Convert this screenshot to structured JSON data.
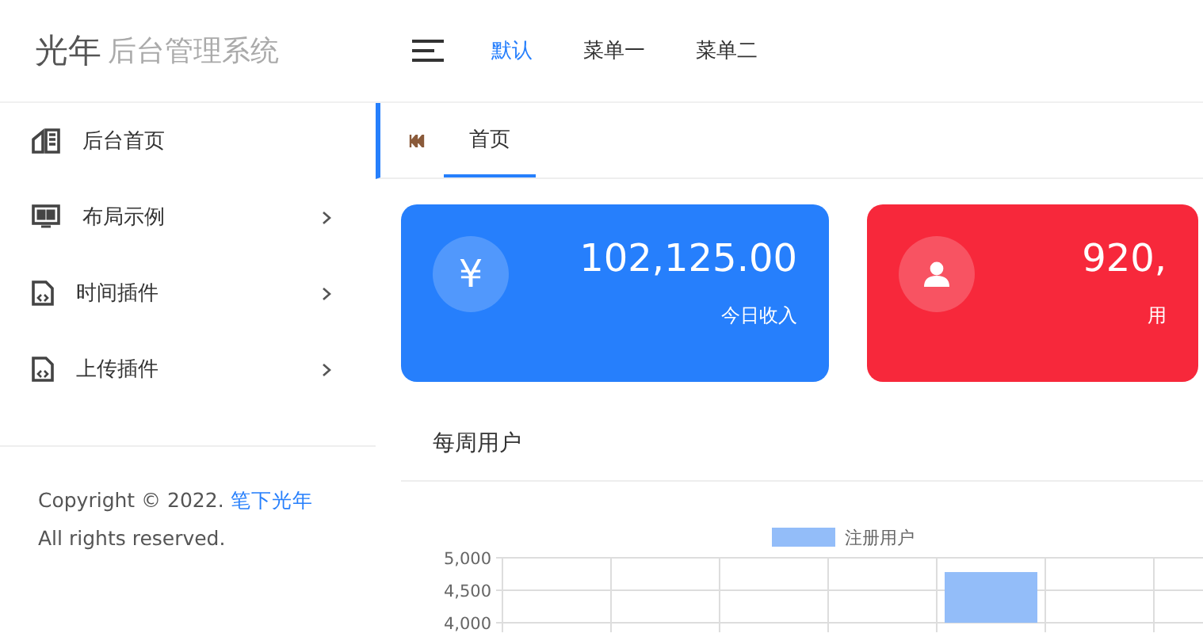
{
  "logo": {
    "mark": "光年",
    "title": "后台管理系统"
  },
  "top_nav": [
    {
      "label": "默认",
      "selected": true
    },
    {
      "label": "菜单一",
      "selected": false
    },
    {
      "label": "菜单二",
      "selected": false
    }
  ],
  "sidebar": {
    "items": [
      {
        "label": "后台首页",
        "kind": "home",
        "has_children": false
      },
      {
        "label": "布局示例",
        "kind": "layout",
        "has_children": true
      },
      {
        "label": "时间插件",
        "kind": "file",
        "has_children": true
      },
      {
        "label": "上传插件",
        "kind": "file",
        "has_children": true
      }
    ],
    "footer": {
      "before": "Copyright © 2022.",
      "link": "笔下光年",
      "after": "All rights reserved."
    }
  },
  "tabs": [
    {
      "label": "首页",
      "selected": true
    }
  ],
  "stat_cards": [
    {
      "kind": "money",
      "value": "102,125.00",
      "label": "今日收入",
      "color": "#267ffc",
      "icon_text": "¥"
    },
    {
      "kind": "user",
      "value": "920,",
      "label": "用",
      "color": "#f7283b"
    }
  ],
  "chart_panel": {
    "title": "每周用户",
    "chart_data": {
      "type": "bar",
      "ylim": [
        4000,
        5000
      ],
      "yticks": [
        {
          "value": 4000,
          "label": "4,000"
        },
        {
          "value": 4500,
          "label": "4,500"
        },
        {
          "value": 5000,
          "label": "5,000"
        }
      ],
      "series": [
        {
          "name": "注册用户",
          "color": "#93bdf9",
          "values": [
            null,
            null,
            null,
            null,
            4780,
            null,
            null
          ]
        }
      ]
    }
  }
}
